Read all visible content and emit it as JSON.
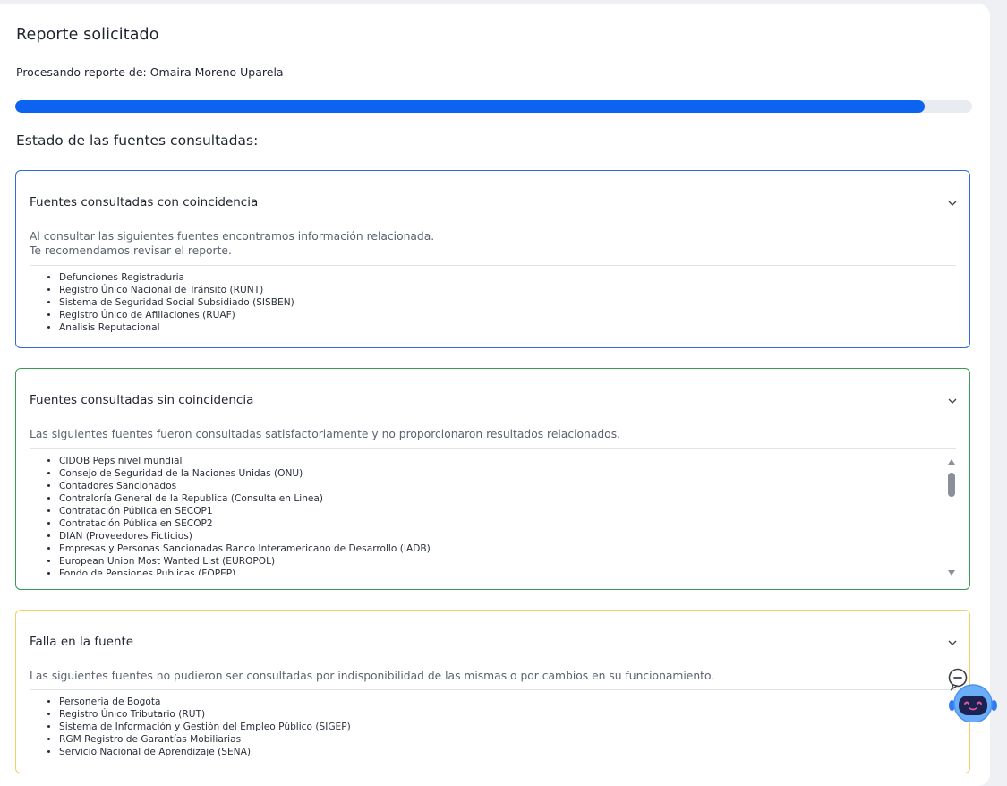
{
  "report": {
    "title": "Reporte solicitado",
    "subtitle": "Procesando reporte de: Omaira Moreno Uparela",
    "progress_fraction": 0.95,
    "sources_heading": "Estado de las fuentes consultadas:"
  },
  "panels": {
    "match": {
      "title": "Fuentes consultadas con coincidencia",
      "desc_line1": "Al consultar las siguientes fuentes encontramos información relacionada.",
      "desc_line2": "Te recomendamos revisar el reporte.",
      "items": [
        "Defunciones Registraduria",
        "Registro Único Nacional de Tránsito (RUNT)",
        "Sistema de Seguridad Social Subsidiado (SISBEN)",
        "Registro Único de Afiliaciones (RUAF)",
        "Analisis Reputacional"
      ]
    },
    "nomatch": {
      "title": "Fuentes consultadas sin coincidencia",
      "desc": "Las siguientes fuentes fueron consultadas satisfactoriamente y no proporcionaron resultados relacionados.",
      "items": [
        "CIDOB Peps nivel mundial",
        "Consejo de Seguridad de la Naciones Unidas (ONU)",
        "Contadores Sancionados",
        "Contraloría General de la Republica (Consulta en Linea)",
        "Contratación Pública en SECOP1",
        "Contratación Pública en SECOP2",
        "DIAN (Proveedores Ficticios)",
        "Empresas y Personas Sancionadas Banco Interamericano de Desarrollo (IADB)",
        "European Union Most Wanted List (EUROPOL)",
        "Fondo de Pensiones Publicas (FOPEP)"
      ]
    },
    "failed": {
      "title": "Falla en la fuente",
      "desc": "Las siguientes fuentes no pudieron ser consultadas por indisponibilidad de las mismas o por cambios en su funcionamiento.",
      "items": [
        "Personeria de Bogota",
        "Registro Único Tributario (RUT)",
        "Sistema de Información y Gestión del Empleo Público (SIGEP)",
        "RGM Registro de Garantías Mobiliarias",
        "Servicio Nacional de Aprendizaje (SENA)"
      ]
    }
  },
  "colors": {
    "progress": "#0b63f0",
    "match_border": "#2f6ad8",
    "nomatch_border": "#3d9a56",
    "failed_border": "#f0d064"
  },
  "icons": {
    "chevron": "chevron-down-icon",
    "chat": "chatbot-icon"
  }
}
